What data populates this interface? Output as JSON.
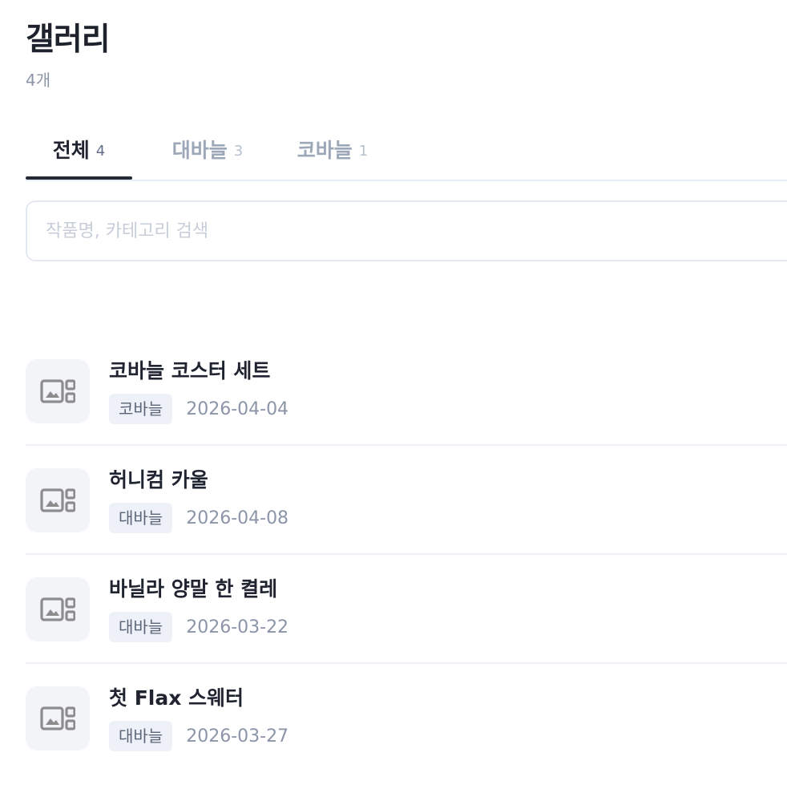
{
  "header": {
    "title": "갤러리",
    "count_text": "4개"
  },
  "tabs": [
    {
      "label": "전체",
      "count": "4",
      "active": true
    },
    {
      "label": "대바늘",
      "count": "3",
      "active": false
    },
    {
      "label": "코바늘",
      "count": "1",
      "active": false
    }
  ],
  "search": {
    "placeholder": "작품명, 카테고리 검색",
    "value": ""
  },
  "items": [
    {
      "title": "코바늘 코스터 세트",
      "category": "코바늘",
      "date": "2026-04-04",
      "thumbnail_icon": "image-placeholder-icon"
    },
    {
      "title": "허니컴 카울",
      "category": "대바늘",
      "date": "2026-04-08",
      "thumbnail_icon": "image-placeholder-icon"
    },
    {
      "title": "바닐라 양말 한 켤레",
      "category": "대바늘",
      "date": "2026-03-22",
      "thumbnail_icon": "image-placeholder-icon"
    },
    {
      "title": "첫 Flax 스웨터",
      "category": "대바늘",
      "date": "2026-03-27",
      "thumbnail_icon": "image-placeholder-icon"
    }
  ],
  "colors": {
    "text_primary": "#1f2430",
    "text_muted": "#8b95a7",
    "tab_inactive": "#9ca7b8",
    "active_underline": "#252b36",
    "badge_bg": "#eef2f8",
    "thumb_bg": "#f2f4f8",
    "border": "#e4e8f0"
  }
}
